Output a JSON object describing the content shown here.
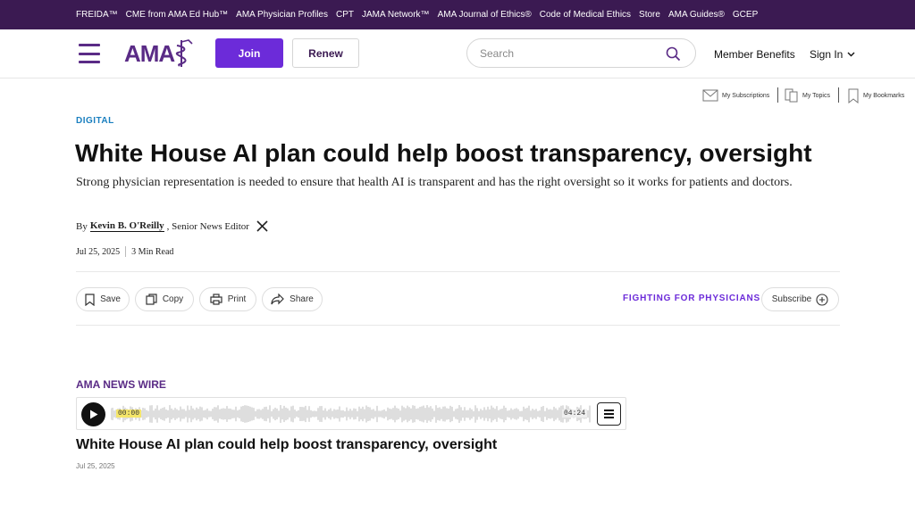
{
  "top_nav": [
    {
      "label": "FREIDA™"
    },
    {
      "label": "CME from AMA Ed Hub™"
    },
    {
      "label": "AMA Physician Profiles"
    },
    {
      "label": "CPT"
    },
    {
      "label": "JAMA Network™"
    },
    {
      "label": "AMA Journal of Ethics®"
    },
    {
      "label": "Code of Medical Ethics"
    },
    {
      "label": "Store"
    },
    {
      "label": "AMA Guides®"
    },
    {
      "label": "GCEP"
    }
  ],
  "header": {
    "logo_text": "AMA",
    "join_label": "Join",
    "renew_label": "Renew",
    "search_placeholder": "Search",
    "member_benefits": "Member Benefits",
    "sign_in": "Sign In"
  },
  "utility": {
    "subscriptions": "My Subscriptions",
    "topics": "My Topics",
    "bookmarks": "My Bookmarks"
  },
  "article": {
    "section": "DIGITAL",
    "headline": "White House AI plan could help boost transparency, oversight",
    "subhead": "Strong physician representation is needed to ensure that health AI is transparent and has the right oversight so it works for patients and doctors.",
    "by": "By",
    "author": "Kevin B. O'Reilly",
    "author_role": ", Senior News Editor",
    "date": "Jul 25, 2025",
    "read_time": "3 Min Read"
  },
  "actions": {
    "save": "Save",
    "copy": "Copy",
    "print": "Print",
    "share": "Share",
    "fighting": "FIGHTING FOR PHYSICIANS",
    "subscribe": "Subscribe"
  },
  "player": {
    "section": "AMA NEWS WIRE",
    "current_time": "00:00",
    "total_time": "04:24",
    "title": "White House AI plan could help boost transparency, oversight",
    "date": "Jul 25, 2025"
  },
  "colors": {
    "topbar": "#3b1a52",
    "brand_purple": "#5a2b86",
    "join_button": "#6c2bd9",
    "section_blue": "#1a7fbf"
  }
}
